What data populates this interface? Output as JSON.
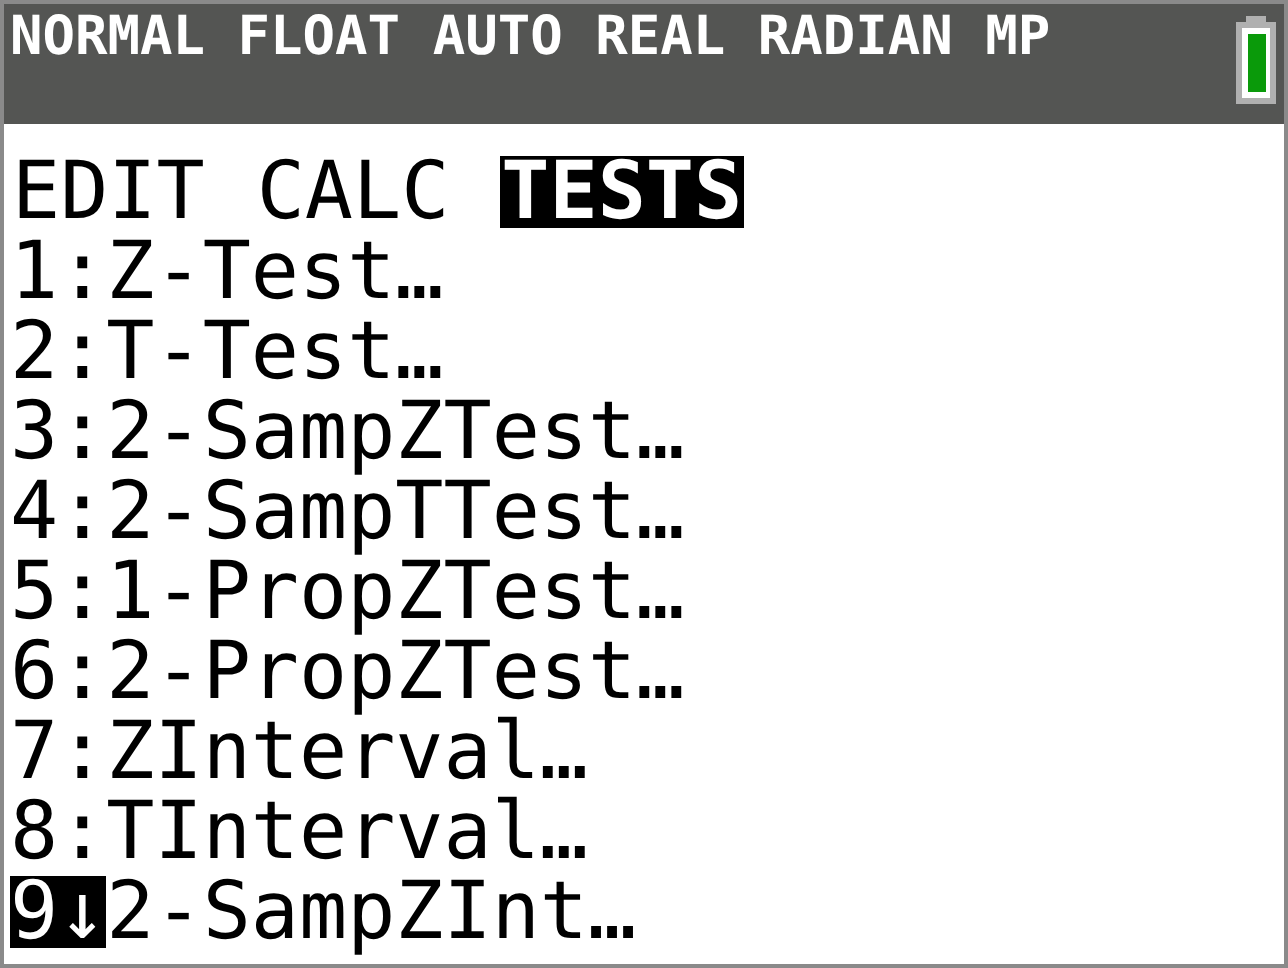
{
  "status_bar": {
    "modes": "NORMAL FLOAT AUTO REAL RADIAN MP"
  },
  "tabs": [
    {
      "label": "EDIT",
      "selected": false
    },
    {
      "label": "CALC",
      "selected": false
    },
    {
      "label": "TESTS",
      "selected": true
    }
  ],
  "items": [
    {
      "key": "1",
      "mark": ":",
      "label": "Z-Test…",
      "selected": false
    },
    {
      "key": "2",
      "mark": ":",
      "label": "T-Test…",
      "selected": false
    },
    {
      "key": "3",
      "mark": ":",
      "label": "2-SampZTest…",
      "selected": false
    },
    {
      "key": "4",
      "mark": ":",
      "label": "2-SampTTest…",
      "selected": false
    },
    {
      "key": "5",
      "mark": ":",
      "label": "1-PropZTest…",
      "selected": false
    },
    {
      "key": "6",
      "mark": ":",
      "label": "2-PropZTest…",
      "selected": false
    },
    {
      "key": "7",
      "mark": ":",
      "label": "ZInterval…",
      "selected": false
    },
    {
      "key": "8",
      "mark": ":",
      "label": "TInterval…",
      "selected": false
    },
    {
      "key": "9",
      "mark": "↓",
      "label": "2-SampZInt…",
      "selected": true
    }
  ]
}
